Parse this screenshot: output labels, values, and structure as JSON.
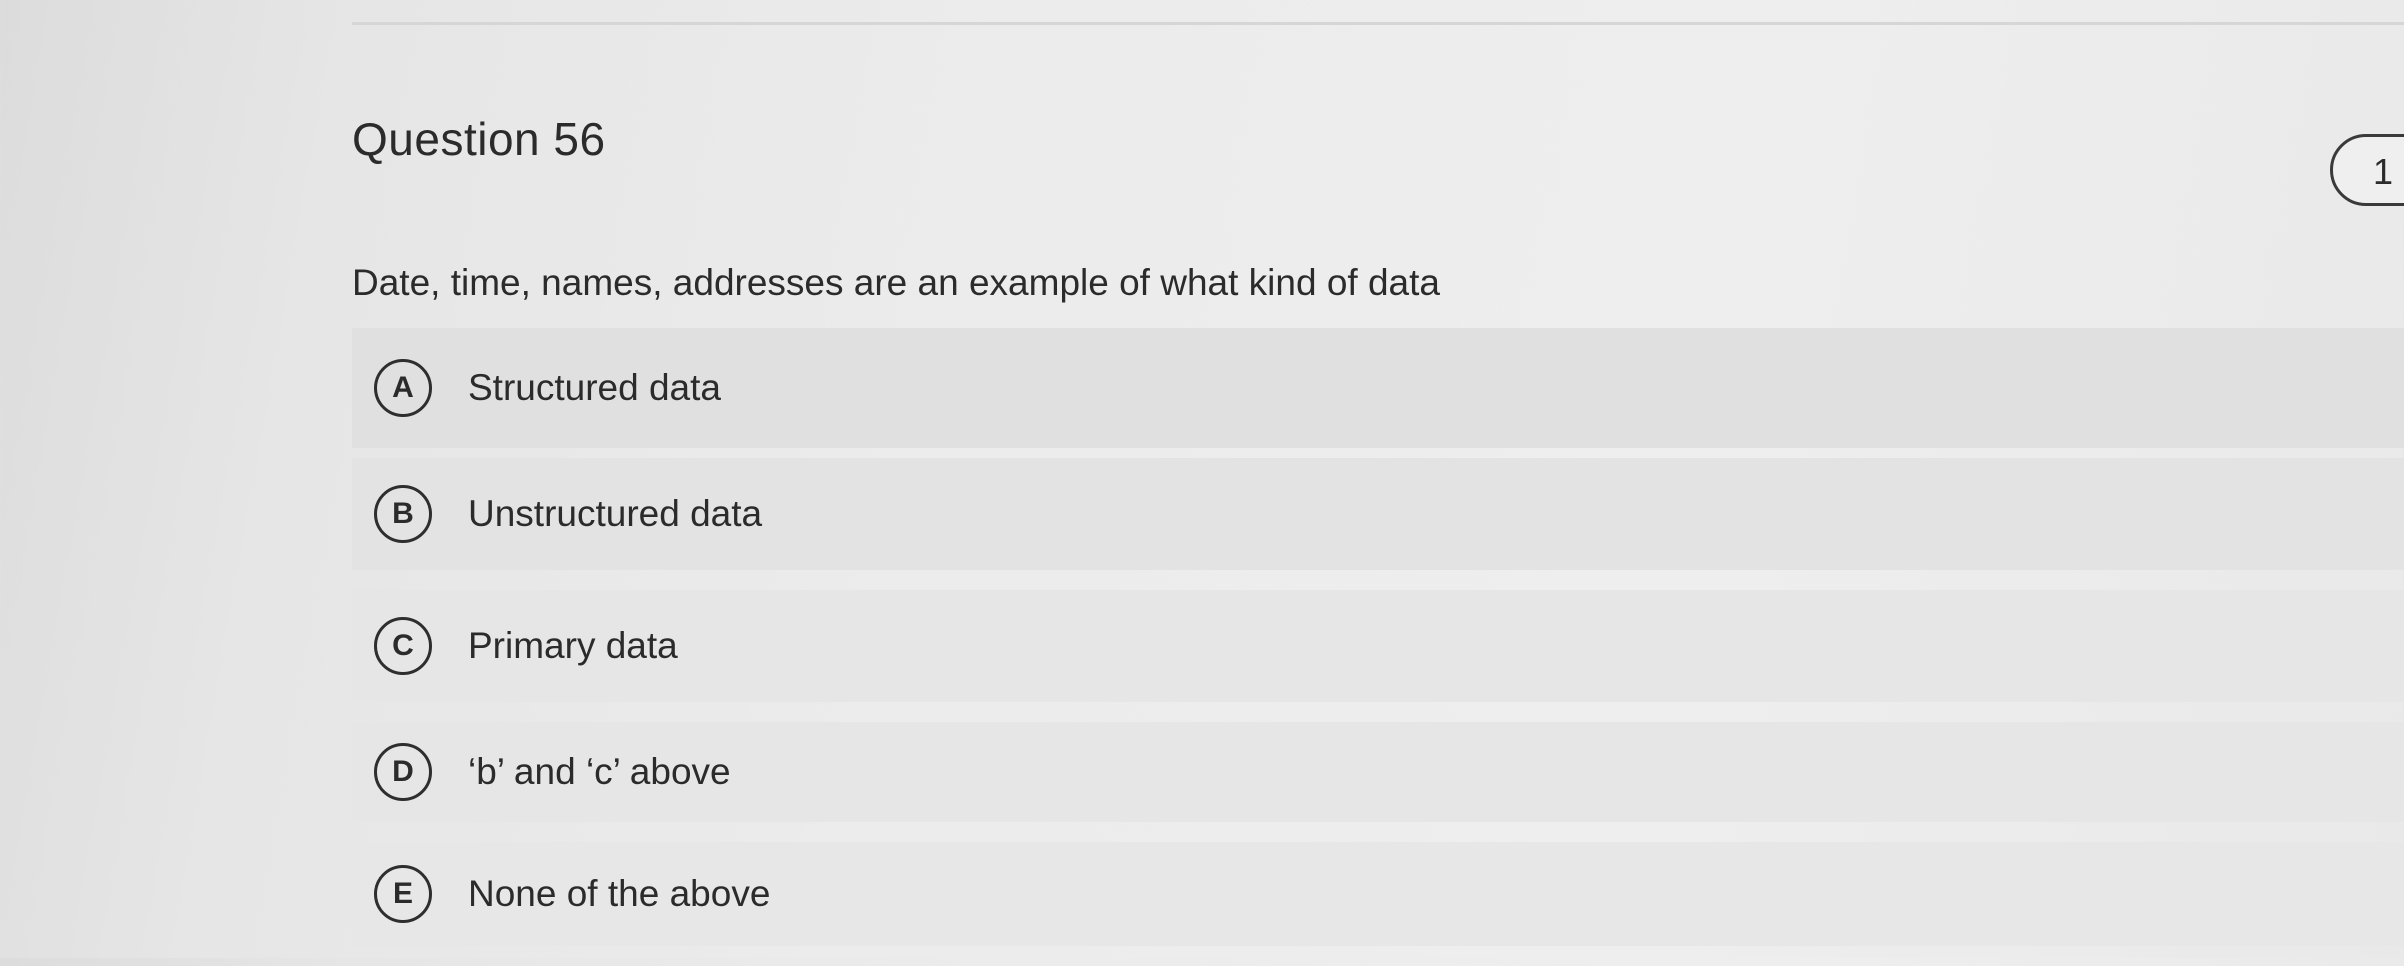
{
  "question": {
    "title": "Question 56",
    "points": "1",
    "prompt": "Date, time, names, addresses are an example of what kind of data"
  },
  "options": [
    {
      "letter": "A",
      "label": "Structured data"
    },
    {
      "letter": "B",
      "label": "Unstructured data"
    },
    {
      "letter": "C",
      "label": "Primary data"
    },
    {
      "letter": "D",
      "label": "‘b’ and ‘c’ above"
    },
    {
      "letter": "E",
      "label": "None of the above"
    }
  ]
}
